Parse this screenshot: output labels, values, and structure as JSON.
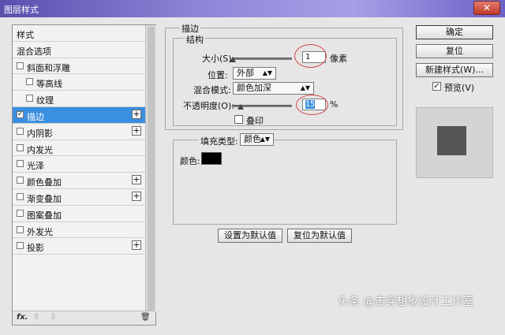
{
  "window": {
    "title": "图层样式",
    "close_glyph": "✕"
  },
  "sidebar": {
    "items": [
      {
        "label": "样式",
        "checkbox": false,
        "indent": 0,
        "selected": false,
        "plus": false
      },
      {
        "label": "混合选项",
        "checkbox": false,
        "indent": 0,
        "selected": false,
        "plus": false
      },
      {
        "label": "斜面和浮雕",
        "checkbox": true,
        "checked": false,
        "indent": 0,
        "selected": false,
        "plus": false
      },
      {
        "label": "等高线",
        "checkbox": true,
        "checked": false,
        "indent": 1,
        "selected": false,
        "plus": false
      },
      {
        "label": "纹理",
        "checkbox": true,
        "checked": false,
        "indent": 1,
        "selected": false,
        "plus": false
      },
      {
        "label": "描边",
        "checkbox": true,
        "checked": true,
        "indent": 0,
        "selected": true,
        "plus": true
      },
      {
        "label": "内阴影",
        "checkbox": true,
        "checked": false,
        "indent": 0,
        "selected": false,
        "plus": true
      },
      {
        "label": "内发光",
        "checkbox": true,
        "checked": false,
        "indent": 0,
        "selected": false,
        "plus": false
      },
      {
        "label": "光泽",
        "checkbox": true,
        "checked": false,
        "indent": 0,
        "selected": false,
        "plus": false
      },
      {
        "label": "颜色叠加",
        "checkbox": true,
        "checked": false,
        "indent": 0,
        "selected": false,
        "plus": true
      },
      {
        "label": "渐变叠加",
        "checkbox": true,
        "checked": false,
        "indent": 0,
        "selected": false,
        "plus": true
      },
      {
        "label": "图案叠加",
        "checkbox": true,
        "checked": false,
        "indent": 0,
        "selected": false,
        "plus": false
      },
      {
        "label": "外发光",
        "checkbox": true,
        "checked": false,
        "indent": 0,
        "selected": false,
        "plus": false
      },
      {
        "label": "投影",
        "checkbox": true,
        "checked": false,
        "indent": 0,
        "selected": false,
        "plus": true
      }
    ],
    "footer": {
      "fx": "fx.",
      "up": "⇧",
      "down": "⇩",
      "trash": "🗑"
    },
    "check_glyph": "✓",
    "plus_glyph": "+"
  },
  "stroke": {
    "section_title": "描边",
    "structure_title": "结构",
    "size": {
      "label": "大小(S):",
      "value": "1",
      "unit": "像素",
      "slider_fraction": 0.01
    },
    "position": {
      "label": "位置:",
      "value": "外部"
    },
    "blend": {
      "label": "混合模式:",
      "value": "颜色加深"
    },
    "opacity": {
      "label": "不透明度(O):",
      "value": "15",
      "unit": "%",
      "slider_fraction": 0.15
    },
    "overprint": {
      "label": "叠印",
      "checked": false
    },
    "fill": {
      "label": "填充类型:",
      "value": "颜色",
      "color_label": "颜色:",
      "color": "#000000"
    }
  },
  "buttons": {
    "make_default": "设置为默认值",
    "reset_default": "复位为默认值",
    "ok": "确定",
    "reset": "复位",
    "new_style": "新建样式(W)...",
    "preview_label": "预览(V)",
    "preview_checked": true
  },
  "preview_fill": "#555555",
  "accent": "#3a8fe0",
  "highlight": "#d8464c",
  "watermark": "头条 @击穿想象设计工作室"
}
